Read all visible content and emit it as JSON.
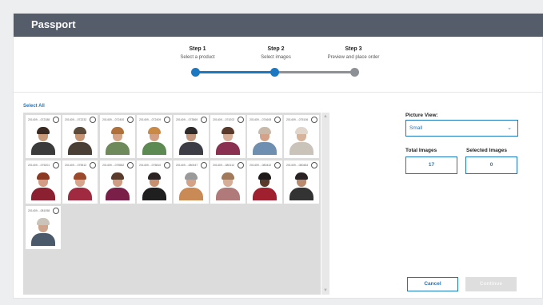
{
  "header": {
    "title": "Passport"
  },
  "steps": [
    {
      "title": "Step 1",
      "subtitle": "Select a product"
    },
    {
      "title": "Step 2",
      "subtitle": "Select images"
    },
    {
      "title": "Step 3",
      "subtitle": "Preview and place order"
    }
  ],
  "current_step": 2,
  "colors": {
    "header_bg": "#555c6a",
    "accent": "#1c78c0",
    "inactive_track": "#8d9196"
  },
  "select_all_label": "Select All",
  "thumbnails": [
    {
      "label": "201409....072188"
    },
    {
      "label": "201409....072232"
    },
    {
      "label": "201409....072400"
    },
    {
      "label": "201409....072409"
    },
    {
      "label": "201409....073569"
    },
    {
      "label": "201409....074202"
    },
    {
      "label": "201409....074608"
    },
    {
      "label": "201409....075106"
    },
    {
      "label": "201409....075201"
    },
    {
      "label": "201409....075512"
    },
    {
      "label": "201409....075582"
    },
    {
      "label": "201409....075810"
    },
    {
      "label": "201409....080047"
    },
    {
      "label": "201409....080112"
    },
    {
      "label": "201409....080442"
    },
    {
      "label": "201409....080484"
    },
    {
      "label": "201409....081058"
    }
  ],
  "picture_view": {
    "label": "Picture View:",
    "value": "Small"
  },
  "total_images": {
    "label": "Total Images",
    "value": "17"
  },
  "selected_images": {
    "label": "Selected Images",
    "value": "0"
  },
  "buttons": {
    "cancel": "Cancel",
    "continue": "Continue"
  }
}
